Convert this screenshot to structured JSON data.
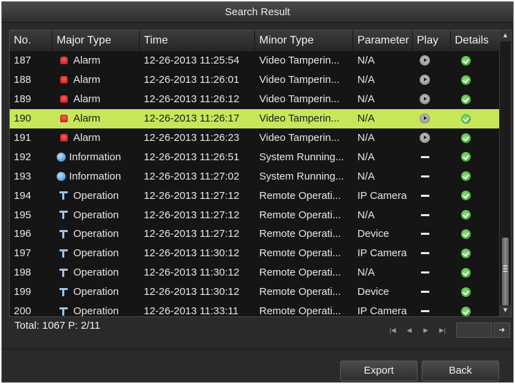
{
  "dialog": {
    "title": "Search Result"
  },
  "table": {
    "headers": {
      "no": "No.",
      "major": "Major Type",
      "time": "Time",
      "minor": "Minor Type",
      "param": "Parameter",
      "play": "Play",
      "details": "Details"
    },
    "rows": [
      {
        "no": "187",
        "type": "alarm",
        "major": "Alarm",
        "time": "12-26-2013 11:25:54",
        "minor": "Video Tamperin...",
        "param": "N/A",
        "play": "play"
      },
      {
        "no": "188",
        "type": "alarm",
        "major": "Alarm",
        "time": "12-26-2013 11:26:01",
        "minor": "Video Tamperin...",
        "param": "N/A",
        "play": "play"
      },
      {
        "no": "189",
        "type": "alarm",
        "major": "Alarm",
        "time": "12-26-2013 11:26:12",
        "minor": "Video Tamperin...",
        "param": "N/A",
        "play": "play"
      },
      {
        "no": "190",
        "type": "alarm",
        "major": "Alarm",
        "time": "12-26-2013 11:26:17",
        "minor": "Video Tamperin...",
        "param": "N/A",
        "play": "play",
        "selected": true
      },
      {
        "no": "191",
        "type": "alarm",
        "major": "Alarm",
        "time": "12-26-2013 11:26:23",
        "minor": "Video Tamperin...",
        "param": "N/A",
        "play": "play"
      },
      {
        "no": "192",
        "type": "info",
        "major": "Information",
        "time": "12-26-2013 11:26:51",
        "minor": "System Running...",
        "param": "N/A",
        "play": "none"
      },
      {
        "no": "193",
        "type": "info",
        "major": "Information",
        "time": "12-26-2013 11:27:02",
        "minor": "System Running...",
        "param": "N/A",
        "play": "none"
      },
      {
        "no": "194",
        "type": "op",
        "major": "Operation",
        "time": "12-26-2013 11:27:12",
        "minor": "Remote Operati...",
        "param": "IP Camera",
        "play": "none"
      },
      {
        "no": "195",
        "type": "op",
        "major": "Operation",
        "time": "12-26-2013 11:27:12",
        "minor": "Remote Operati...",
        "param": "N/A",
        "play": "none"
      },
      {
        "no": "196",
        "type": "op",
        "major": "Operation",
        "time": "12-26-2013 11:27:12",
        "minor": "Remote Operati...",
        "param": "Device",
        "play": "none"
      },
      {
        "no": "197",
        "type": "op",
        "major": "Operation",
        "time": "12-26-2013 11:30:12",
        "minor": "Remote Operati...",
        "param": "IP Camera",
        "play": "none"
      },
      {
        "no": "198",
        "type": "op",
        "major": "Operation",
        "time": "12-26-2013 11:30:12",
        "minor": "Remote Operati...",
        "param": "N/A",
        "play": "none"
      },
      {
        "no": "199",
        "type": "op",
        "major": "Operation",
        "time": "12-26-2013 11:30:12",
        "minor": "Remote Operati...",
        "param": "Device",
        "play": "none"
      },
      {
        "no": "200",
        "type": "op",
        "major": "Operation",
        "time": "12-26-2013 11:33:11",
        "minor": "Remote Operati...",
        "param": "IP Camera",
        "play": "none"
      }
    ]
  },
  "footer": {
    "summary": "Total: 1067  P: 2/11",
    "page_input": ""
  },
  "buttons": {
    "export": "Export",
    "back": "Back"
  },
  "colors": {
    "selected_row": "#c8e65a",
    "background": "#2a2a2a"
  }
}
